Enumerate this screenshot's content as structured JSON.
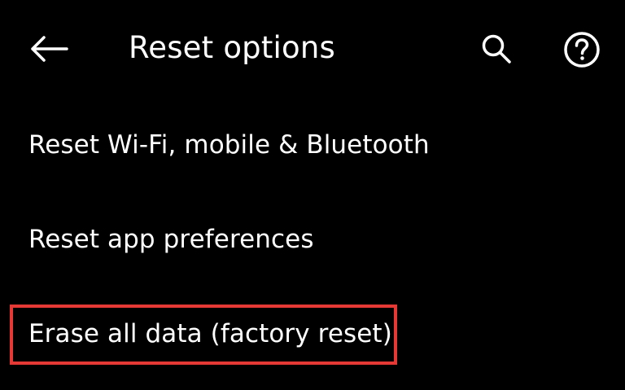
{
  "app_bar": {
    "title": "Reset options",
    "back_icon": "arrow-left-icon",
    "search_icon": "search-icon",
    "help_icon": "help-circle-icon"
  },
  "options": [
    {
      "label": "Reset Wi-Fi, mobile & Bluetooth"
    },
    {
      "label": "Reset app preferences"
    },
    {
      "label": "Erase all data (factory reset)"
    }
  ],
  "colors": {
    "background": "#000000",
    "text": "#ffffff",
    "highlight": "#e53935"
  }
}
